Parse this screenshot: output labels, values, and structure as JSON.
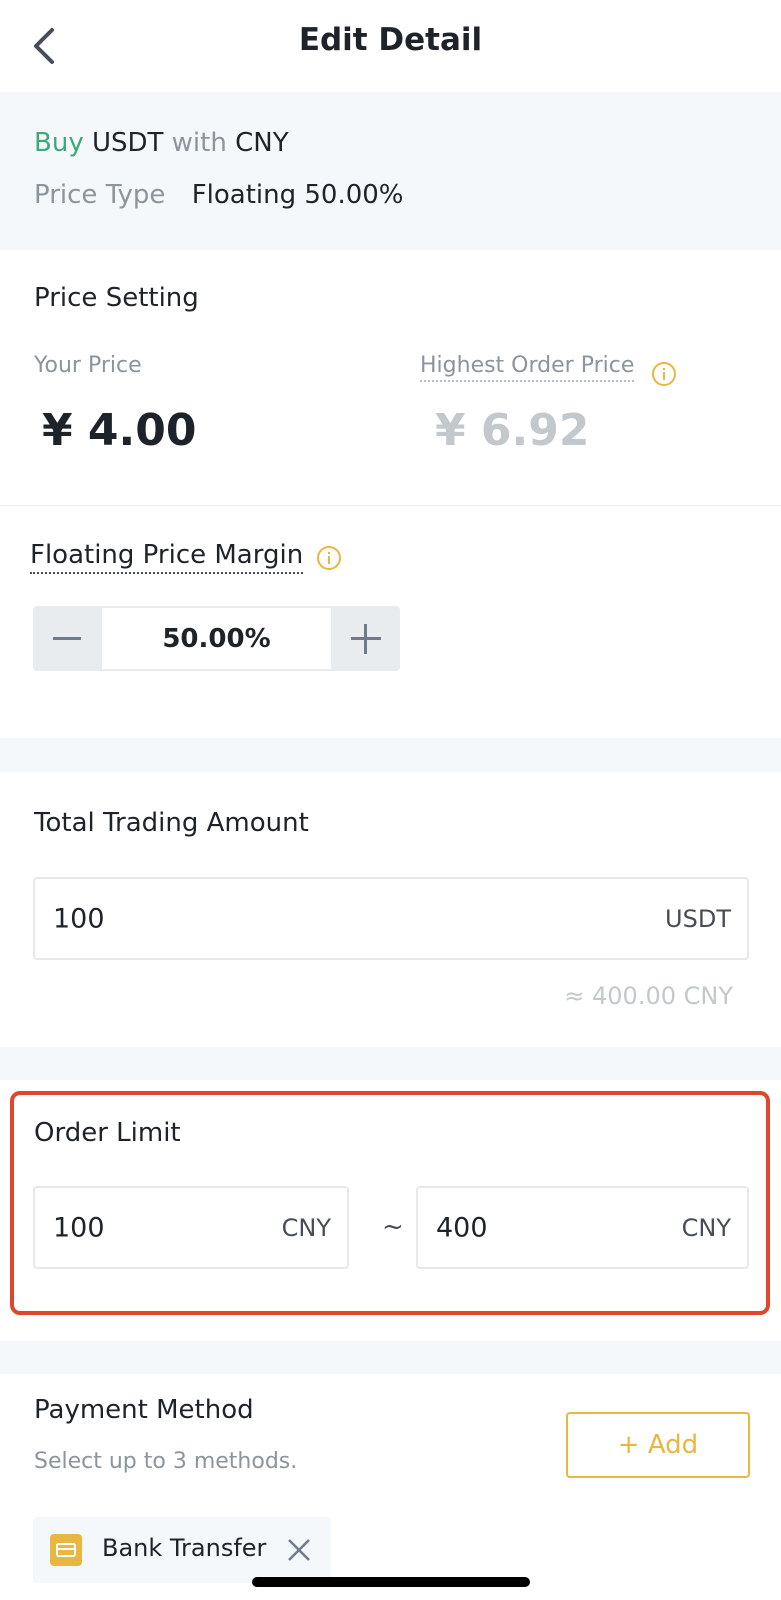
{
  "header": {
    "title": "Edit Detail",
    "back_icon": "chevron-left-icon"
  },
  "trade": {
    "buy_word": "Buy",
    "asset": "USDT",
    "with_word": "with",
    "fiat": "CNY",
    "price_type_label": "Price Type",
    "price_type_value": "Floating 50.00%"
  },
  "price_setting": {
    "title": "Price Setting",
    "your_price_label": "Your Price",
    "your_price_value": "¥ 4.00",
    "highest_label": "Highest Order Price",
    "highest_value": "¥ 6.92",
    "info_icon": "info-circle-icon"
  },
  "floating": {
    "label": "Floating Price Margin",
    "value": "50.00%",
    "minus_icon": "minus-icon",
    "plus_icon": "plus-icon"
  },
  "total_amount": {
    "title": "Total Trading Amount",
    "value": "100",
    "unit": "USDT",
    "approx": "≈ 400.00 CNY"
  },
  "order_limit": {
    "title": "Order Limit",
    "min_value": "100",
    "min_unit": "CNY",
    "separator": "~",
    "max_value": "400",
    "max_unit": "CNY"
  },
  "payment": {
    "title": "Payment Method",
    "hint": "Select up to 3 methods.",
    "add_label": "+ Add",
    "methods": [
      {
        "label": "Bank Transfer",
        "icon": "bank-card-icon"
      }
    ]
  },
  "colors": {
    "buy_green": "#3fa87b",
    "accent_yellow": "#e8b73f",
    "highlight_red": "#e0452e"
  }
}
